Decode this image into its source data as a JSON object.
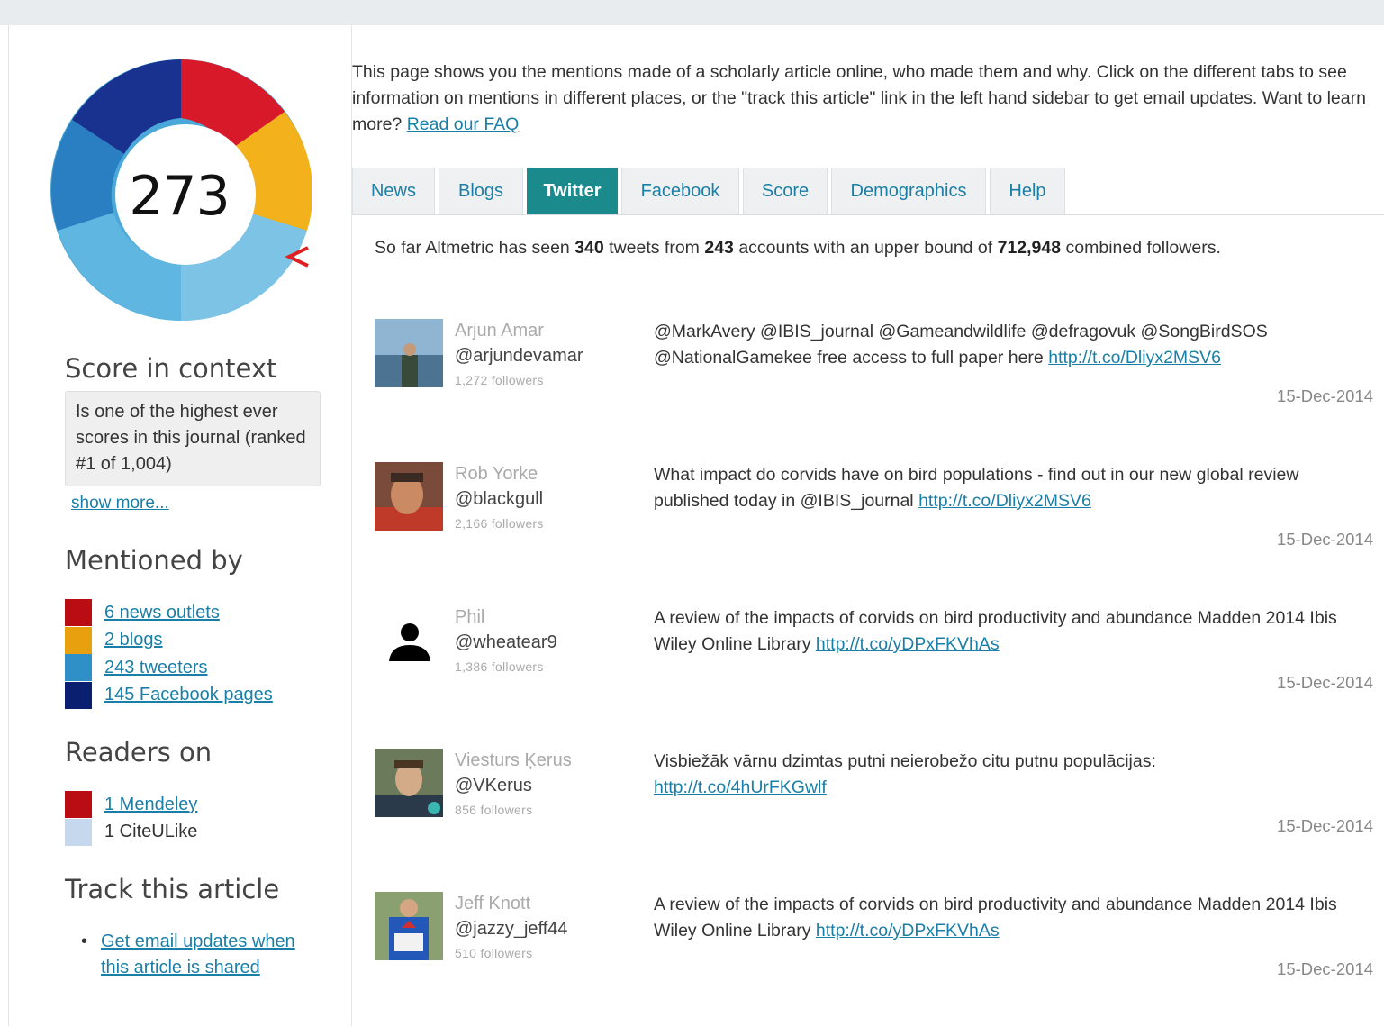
{
  "score": {
    "value": "273"
  },
  "intro": {
    "text": "This page shows you the mentions made of a scholarly article online, who made them and why. Click on the different tabs to see information on mentions in different places, or the \"track this article\" link in the left hand sidebar to get email updates. Want to learn more? ",
    "faq_link": "Read our FAQ"
  },
  "sidebar": {
    "score_context": {
      "heading": "Score in context",
      "text": "Is one of the highest ever scores in this journal (ranked #1 of 1,004)",
      "show_more": "show more..."
    },
    "mentioned_by": {
      "heading": "Mentioned by",
      "items": [
        {
          "label": "6 news outlets",
          "color": "#b90d13",
          "link": true
        },
        {
          "label": "2 blogs",
          "color": "#e8a00e",
          "link": true
        },
        {
          "label": "243 tweeters",
          "color": "#2f90c8",
          "link": true
        },
        {
          "label": "145 Facebook pages",
          "color": "#0a1f6f",
          "link": true
        }
      ]
    },
    "readers_on": {
      "heading": "Readers on",
      "items": [
        {
          "label": "1 Mendeley",
          "color": "#b90d13",
          "link": true
        },
        {
          "label": "1 CiteULike",
          "color": "#c5d8ee",
          "link": false
        }
      ]
    },
    "track": {
      "heading": "Track this article",
      "link_line1": "Get email updates when",
      "link_line2": "this article is shared"
    }
  },
  "tabs": [
    {
      "label": "News",
      "active": false
    },
    {
      "label": "Blogs",
      "active": false
    },
    {
      "label": "Twitter",
      "active": true
    },
    {
      "label": "Facebook",
      "active": false
    },
    {
      "label": "Score",
      "active": false
    },
    {
      "label": "Demographics",
      "active": false
    },
    {
      "label": "Help",
      "active": false
    }
  ],
  "summary": {
    "prefix": "So far Altmetric has seen ",
    "tweets": "340",
    "mid1": " tweets from ",
    "accounts": "243",
    "mid2": " accounts with an upper bound of ",
    "followers": "712,948",
    "suffix": " combined followers."
  },
  "tweets": [
    {
      "name": "Arjun Amar",
      "handle": "@arjundevamar",
      "followers": "1,272 followers",
      "text": "@MarkAvery @IBIS_journal @Gameandwildlife @defragovuk @SongBirdSOS @NationalGamekee free access to full paper here ",
      "link": "http://t.co/Dliyx2MSV6",
      "date": "15-Dec-2014",
      "avatar": "photo-sea"
    },
    {
      "name": "Rob Yorke",
      "handle": "@blackgull",
      "followers": "2,166 followers",
      "text": "What impact do corvids have on bird populations - find out in our new global review published today in @IBIS_journal ",
      "link": "http://t.co/Dliyx2MSV6",
      "date": "15-Dec-2014",
      "avatar": "photo-face"
    },
    {
      "name": "Phil",
      "handle": "@wheatear9",
      "followers": "1,386 followers",
      "text": "A review of the impacts of corvids on bird productivity and abundance Madden 2014 Ibis Wiley Online Library ",
      "link": "http://t.co/yDPxFKVhAs",
      "date": "15-Dec-2014",
      "avatar": "silhouette"
    },
    {
      "name": "Viesturs Ķerus",
      "handle": "@VKerus",
      "followers": "856 followers",
      "text": "Visbiežāk vārnu dzimtas putni neierobežo citu putnu populācijas: ",
      "link": "http://t.co/4hUrFKGwlf",
      "date": "15-Dec-2014",
      "avatar": "photo-face2"
    },
    {
      "name": "Jeff Knott",
      "handle": "@jazzy_jeff44",
      "followers": "510 followers",
      "text": "A review of the impacts of corvids on bird productivity and abundance Madden 2014 Ibis Wiley Online Library ",
      "link": "http://t.co/yDPxFKVhAs",
      "date": "15-Dec-2014",
      "avatar": "photo-superman"
    }
  ]
}
